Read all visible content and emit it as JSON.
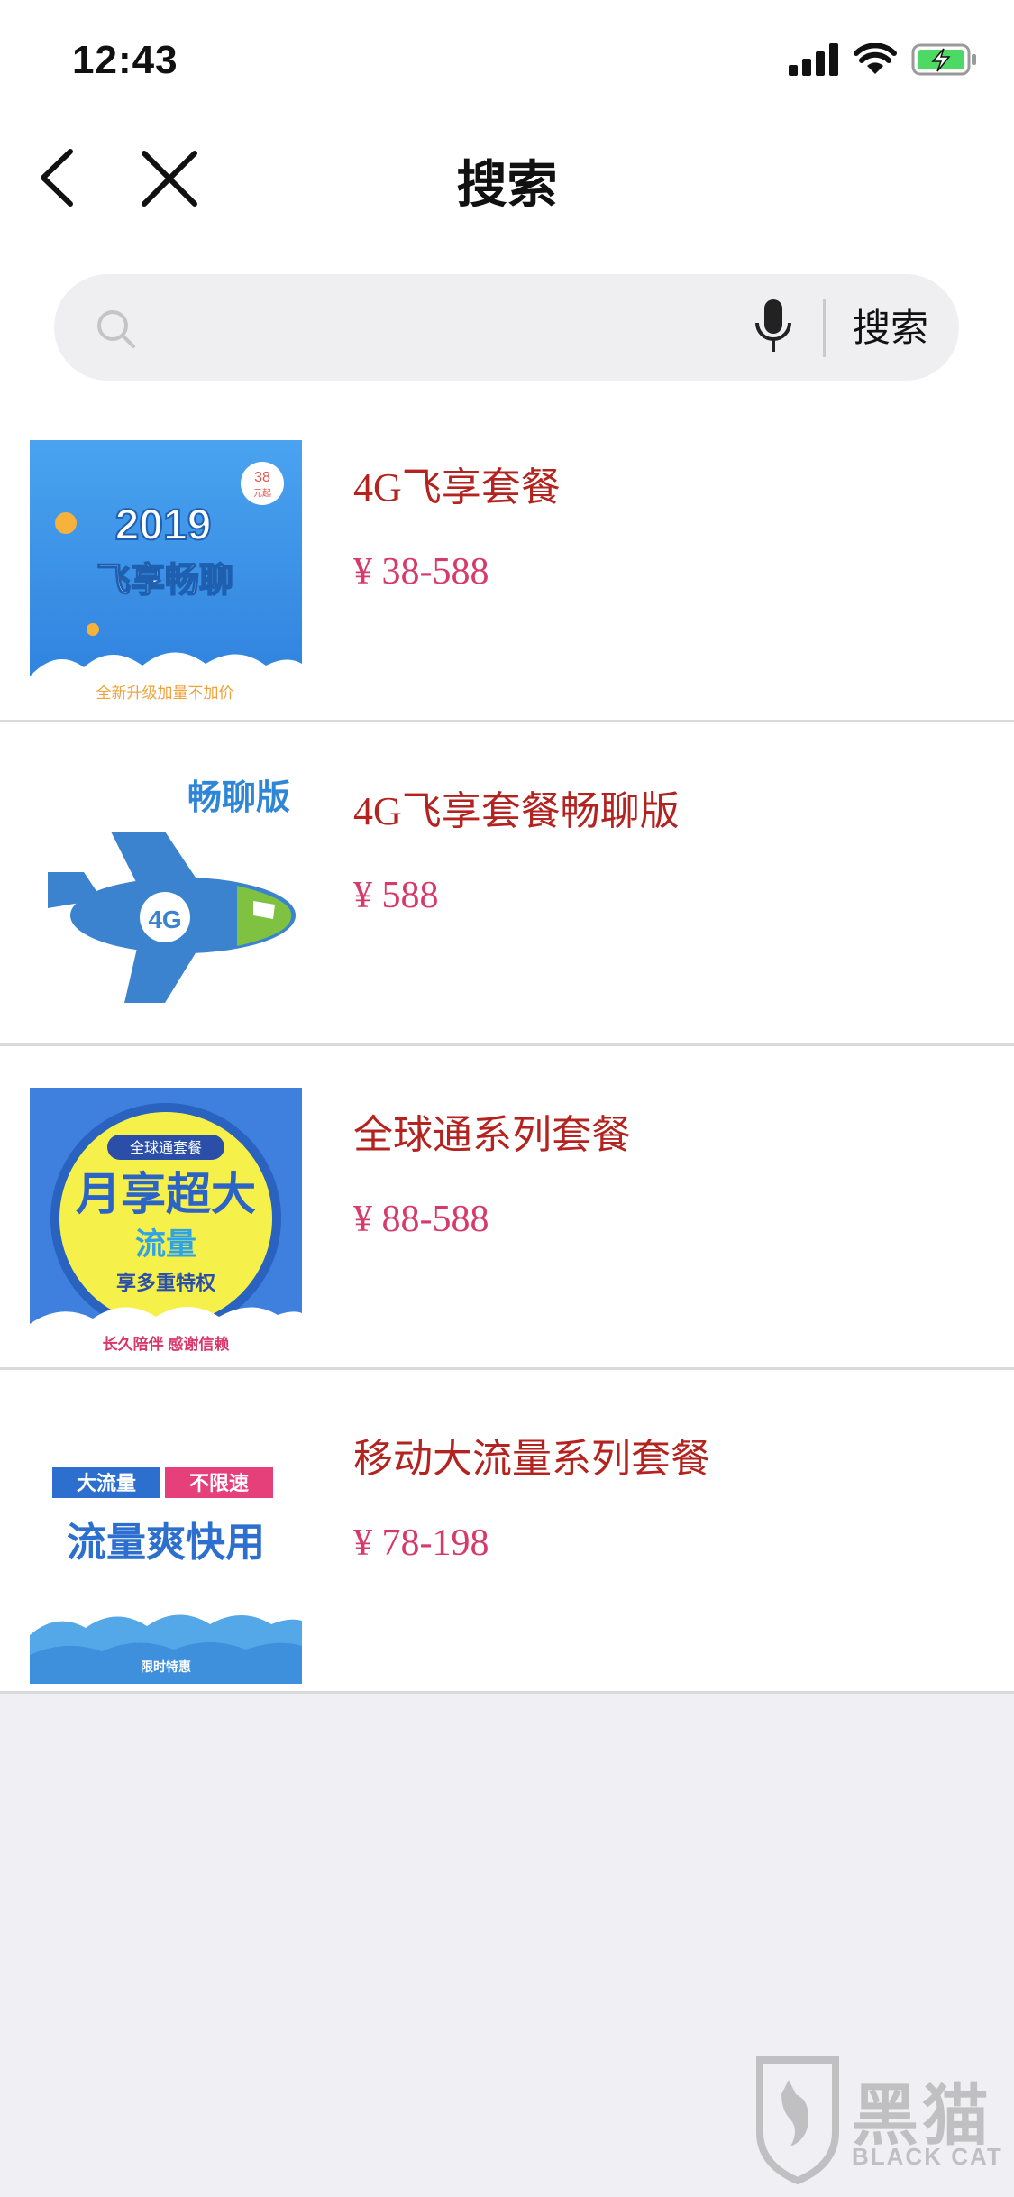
{
  "status_bar": {
    "time": "12:43"
  },
  "nav": {
    "title": "搜索"
  },
  "search": {
    "placeholder": "",
    "button_label": "搜索"
  },
  "results": [
    {
      "title": "4G飞享套餐",
      "price": "¥ 38-588",
      "thumb": {
        "title": "2019",
        "subtitle": "飞享畅聊",
        "footer": "全新升级加量不加价",
        "badge_top": "38",
        "badge_bottom": "元起"
      }
    },
    {
      "title": "4G飞享套餐畅聊版",
      "price": "¥ 588",
      "thumb": {
        "label": "畅聊版",
        "plane_text": "4G"
      }
    },
    {
      "title": "全球通系列套餐",
      "price": "¥ 88-588",
      "thumb": {
        "tag": "全球通套餐",
        "headline": "月享超大",
        "line2": "流量",
        "line3": "享多重特权",
        "footer": "长久陪伴  感谢信赖"
      }
    },
    {
      "title": "移动大流量系列套餐",
      "price": "¥ 78-198",
      "thumb": {
        "tag_left": "大流量",
        "tag_right": "不限速",
        "headline": "流量爽快用",
        "footer": "限时特惠"
      }
    }
  ],
  "watermark": {
    "cn": "黑猫",
    "en": "BLACK CAT"
  },
  "colors": {
    "title_red": "#b3231f",
    "price_pink": "#d63a6b",
    "battery_green": "#4cd964"
  }
}
